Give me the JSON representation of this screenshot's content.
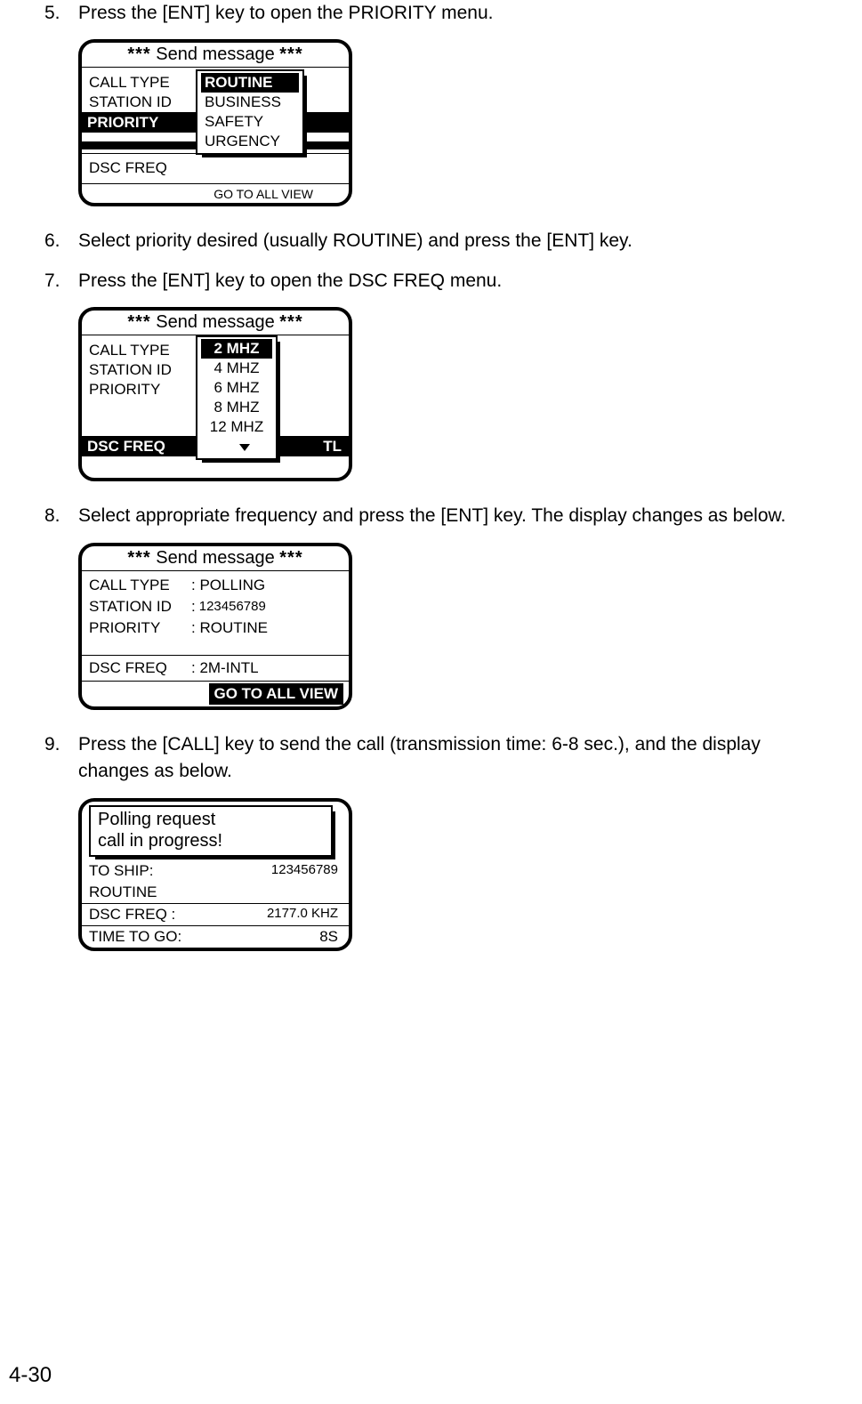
{
  "steps": {
    "s5": {
      "num": "5.",
      "text": "Press the [ENT] key to open the PRIORITY menu."
    },
    "s6": {
      "num": "6.",
      "text": "Select priority desired (usually ROUTINE) and press the [ENT] key."
    },
    "s7": {
      "num": "7.",
      "text": "Press the [ENT] key to open the DSC FREQ menu."
    },
    "s8": {
      "num": "8.",
      "text": "Select appropriate frequency and press the [ENT] key. The display changes as below."
    },
    "s9": {
      "num": "9.",
      "text": "Press the [CALL] key to send the call (transmission time: 6-8 sec.), and the display changes as below."
    }
  },
  "screen1": {
    "stars": "***",
    "title": "Send message",
    "labels": {
      "call_type": "CALL TYPE",
      "station_id": "STATION ID",
      "priority": "PRIORITY",
      "dsc_freq": "DSC FREQ"
    },
    "popup": {
      "routine": "ROUTINE",
      "business": "BUSINESS",
      "safety": "SAFETY",
      "urgency": "URGENCY"
    },
    "footer": "GO TO ALL VIEW"
  },
  "screen2": {
    "stars": "***",
    "title": "Send message",
    "labels": {
      "call_type": "CALL TYPE",
      "station_id": "STATION ID",
      "priority": "PRIORITY",
      "dsc_freq": "DSC FREQ"
    },
    "tl": "TL",
    "popup": {
      "f2": "2 MHZ",
      "f4": "4 MHZ",
      "f6": "6 MHZ",
      "f8": "8 MHZ",
      "f12": "12 MHZ"
    }
  },
  "screen3": {
    "stars": "***",
    "title": "Send message",
    "rows": {
      "call_type_k": "CALL TYPE",
      "call_type_v": ": POLLING",
      "station_id_k": "STATION ID",
      "station_id_v_prefix": ":",
      "station_id_v": "123456789",
      "priority_k": "PRIORITY",
      "priority_v": ": ROUTINE",
      "dsc_freq_k": "DSC FREQ",
      "dsc_freq_v": ": 2M-INTL"
    },
    "footer": "GO TO ALL VIEW"
  },
  "screen4": {
    "line1": "Polling request",
    "line2": "call in progress!",
    "to_ship_k": "TO SHIP:",
    "to_ship_v": "123456789",
    "routine": "ROUTINE",
    "dsc_freq_k": "DSC FREQ  :",
    "dsc_freq_v": "2177.0 KHZ",
    "time_k": "TIME TO GO:",
    "time_v": "8S"
  },
  "page_number": "4-30"
}
